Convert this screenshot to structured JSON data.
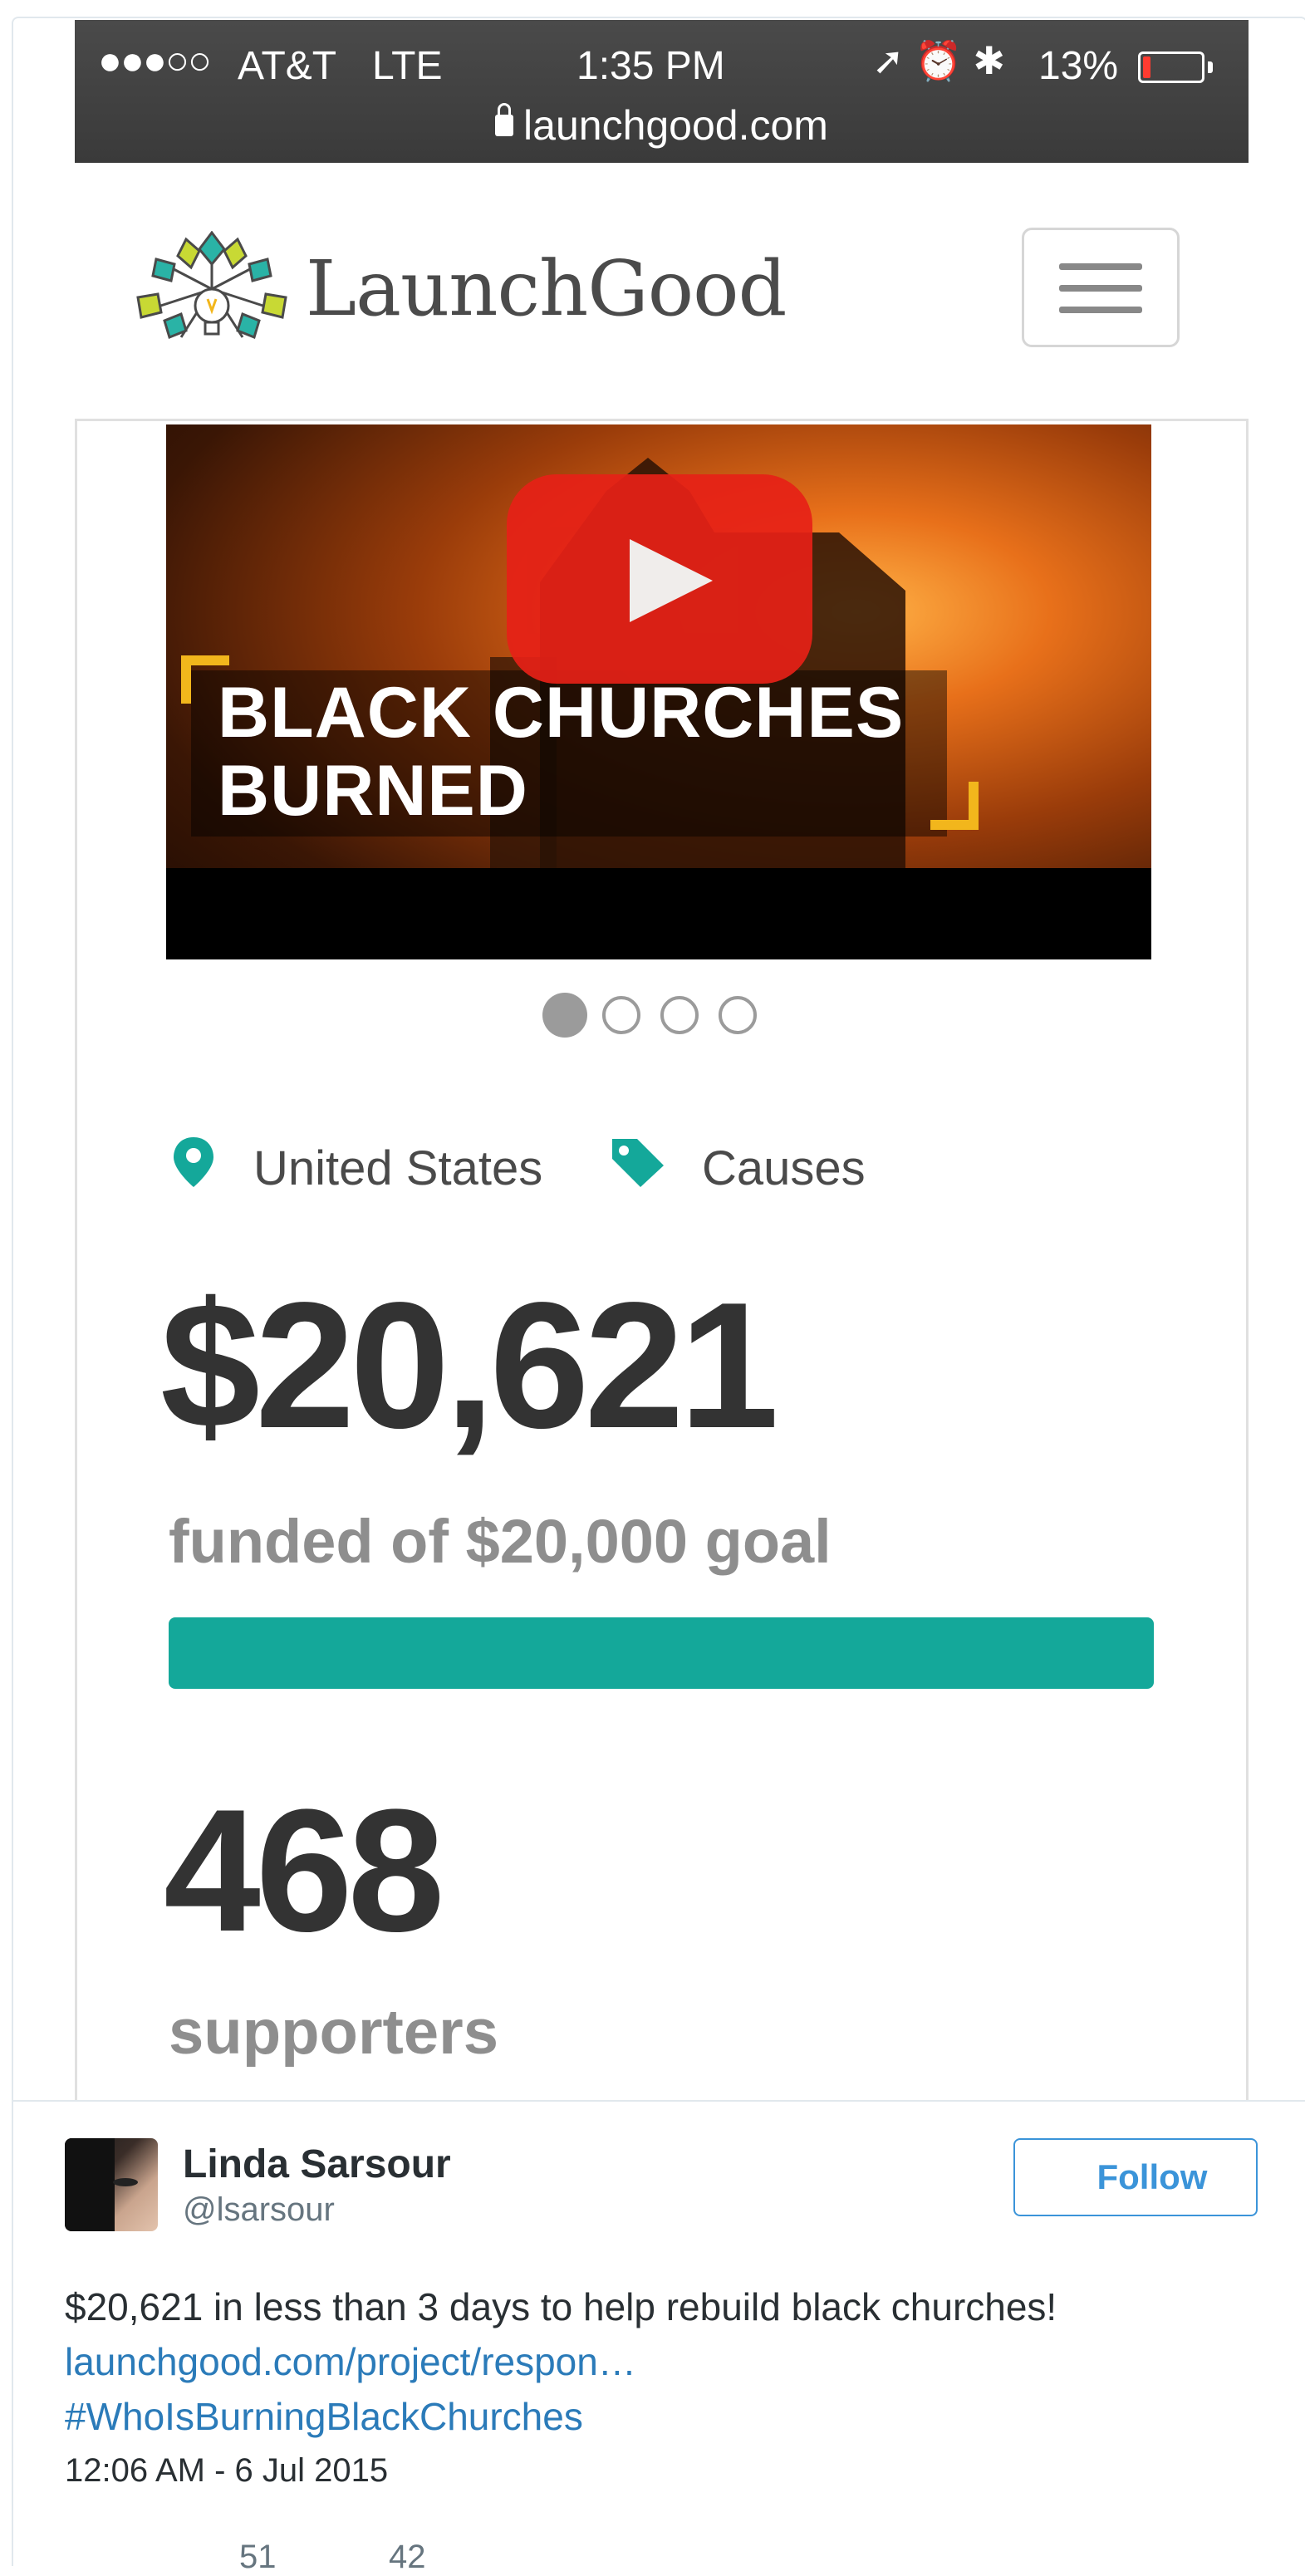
{
  "status_bar": {
    "signal": "●●●○○",
    "carrier": "AT&T",
    "network": "LTE",
    "time": "1:35 PM",
    "icons": "➚ ⏰ ✱",
    "battery": "13%",
    "battery_level": 0.13,
    "url": "launchgood.com"
  },
  "header": {
    "logo_text": "LaunchGood",
    "logo_colors": [
      "#2ab3a6",
      "#c8d934",
      "#4a4a4a"
    ]
  },
  "video": {
    "caption_line1": "BLACK CHURCHES",
    "caption_line2": "BURNED",
    "play_icon": "play-icon"
  },
  "carousel": {
    "total": 4,
    "active_index": 0
  },
  "campaign": {
    "location": "United States",
    "category": "Causes",
    "funded_amount": "$20,621",
    "funded_goal": "funded of $20,000 goal",
    "progress_fraction": 1.0,
    "supporters_count": "468",
    "supporters_label": "supporters",
    "accent_color": "#14a89a"
  },
  "tweet": {
    "author_name": "Linda Sarsour",
    "author_handle": "@lsarsour",
    "follow_label": "Follow",
    "text": "$20,621 in less than 3 days to help rebuild black churches!",
    "link": "launchgood.com/project/respon…",
    "hashtag": "#WhoIsBurningBlackChurches",
    "timestamp": "12:06 AM - 6 Jul 2015",
    "stat_1": "51",
    "stat_2": "42",
    "link_color": "#2b7bb9"
  }
}
